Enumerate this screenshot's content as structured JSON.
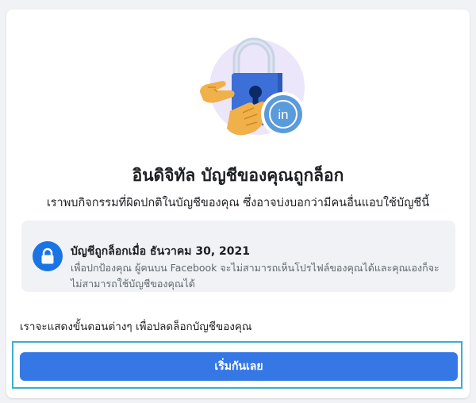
{
  "header": {
    "title": "อินดิจิทัล บัญชีของคุณถูกล็อก",
    "subtitle": "เราพบกิจกรรมที่ผิดปกติในบัญชีของคุณ ซึ่งอาจบ่งบอกว่ามีคนอื่นแอบใช้บัญชีนี้"
  },
  "hero": {
    "lock_icon": "padlock-icon",
    "badge_text": "in",
    "colors": {
      "lock": "#3d6fd9",
      "shackle": "#c9d3e6",
      "badge": "#5a9bdc",
      "hand": "#f0b04a",
      "backdrop": "#ece6fb"
    }
  },
  "notice": {
    "icon": "lock-icon",
    "title": "บัญชีถูกล็อกเมื่อ ธันวาคม 30, 2021",
    "body": "เพื่อปกป้องคุณ ผู้คนบน Facebook จะไม่สามารถเห็นโปรไฟล์ของคุณได้และคุณเองก็จะไม่สามารถใช้บัญชีของคุณได้"
  },
  "steps_text": "เราจะแสดงขั้นตอนต่างๆ เพื่อปลดล็อกบัญชีของคุณ",
  "start_button": {
    "label": "เริ่มกันเลย",
    "color": "#3578e5"
  }
}
